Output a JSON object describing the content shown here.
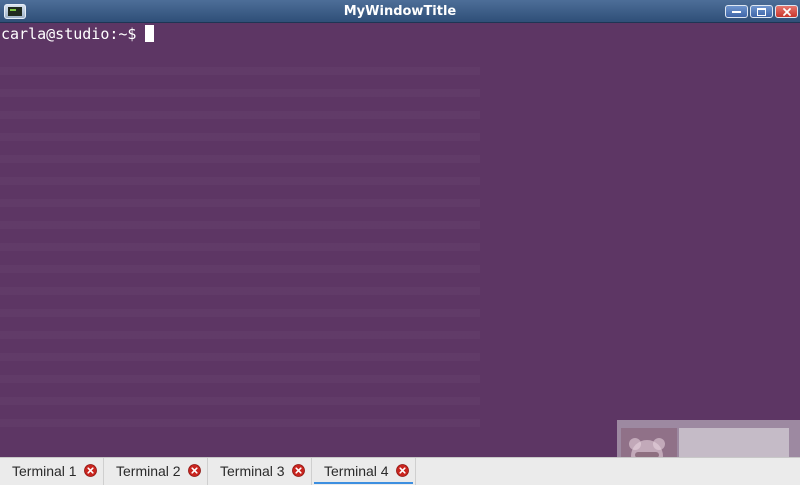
{
  "window": {
    "title": "MyWindowTitle"
  },
  "terminal": {
    "prompt": "carla@studio:~$"
  },
  "tabs": [
    {
      "label": "Terminal 1",
      "active": false
    },
    {
      "label": "Terminal 2",
      "active": false
    },
    {
      "label": "Terminal 3",
      "active": false
    },
    {
      "label": "Terminal 4",
      "active": true
    }
  ],
  "colors": {
    "terminal_background": "#5d3664",
    "titlebar": "#3b5c87",
    "active_tab_indicator": "#3d8fe0",
    "tab_close": "#c9251f"
  },
  "icons": {
    "app": "terminal-app-icon",
    "minimize": "minimize-icon",
    "maximize": "maximize-icon",
    "close": "close-icon",
    "tab_close": "tab-close-icon"
  }
}
